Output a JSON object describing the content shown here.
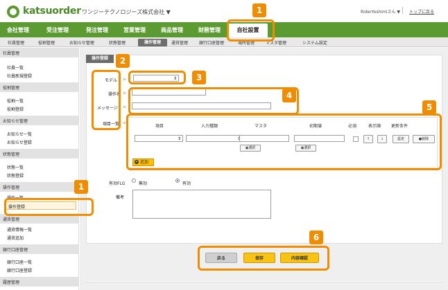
{
  "header": {
    "logo_text": "katsuorder",
    "company": "ワンジーテクノロジーズ株式会社 ▼",
    "user": "RiderYoshimiさん ▼",
    "top_link": "トップに戻る"
  },
  "main_nav": [
    "会社管理",
    "受注管理",
    "発注管理",
    "営業管理",
    "商品管理",
    "財務管理",
    "自社設置"
  ],
  "sub_nav": [
    "社員管理",
    "役割管理",
    "お知らせ管理",
    "状態管理",
    "操作管理",
    "通貨管理",
    "銀行口座管理",
    "場所管理",
    "マスタ管理",
    "システム設定"
  ],
  "sidebar": {
    "sections": [
      {
        "title": "社員管理",
        "items": [
          "社員一覧",
          "社員新規登録"
        ]
      },
      {
        "title": "役割管理",
        "items": [
          "役割一覧",
          "役割登録"
        ]
      },
      {
        "title": "お知らせ管理",
        "items": [
          "お知らせ一覧",
          "お知らせ登録"
        ]
      },
      {
        "title": "状態管理",
        "items": [
          "状態一覧",
          "状態登録"
        ]
      },
      {
        "title": "操作管理",
        "items": [
          "操作一覧",
          "操作登録"
        ]
      },
      {
        "title": "通貨管理",
        "items": [
          "通貨情報一覧",
          "通貨追加"
        ]
      },
      {
        "title": "銀行口座管理",
        "items": [
          "銀行口座一覧",
          "銀行口座登録"
        ]
      },
      {
        "title": "履歴管理",
        "items": []
      }
    ],
    "selected": "操作登録"
  },
  "form": {
    "title": "操作登録",
    "model_label": "モデル",
    "operation_name_label": "操作名",
    "message_label": "メッセージ",
    "item_list_label": "項目一覧",
    "required_mark": "≡",
    "table_headers": [
      "項目",
      "入力種類",
      "マスタ",
      "初期値",
      "必須",
      "表示順",
      "更新条件"
    ],
    "select_button": "選択",
    "setting_button": "設定",
    "delete_button": "削除",
    "add_button": "追加",
    "active_flag_label": "有効FLG",
    "inactive_label": "無効",
    "active_label": "有効",
    "memo_label": "備考"
  },
  "buttons": {
    "back": "戻る",
    "save": "保存",
    "confirm": "内容確認"
  },
  "annotations": {
    "one": "1",
    "two": "2",
    "three": "3",
    "four": "4",
    "five": "5",
    "six": "6"
  },
  "colors": {
    "brand": "#5c9b32",
    "highlight": "#f08c00",
    "button": "#f9c313"
  }
}
